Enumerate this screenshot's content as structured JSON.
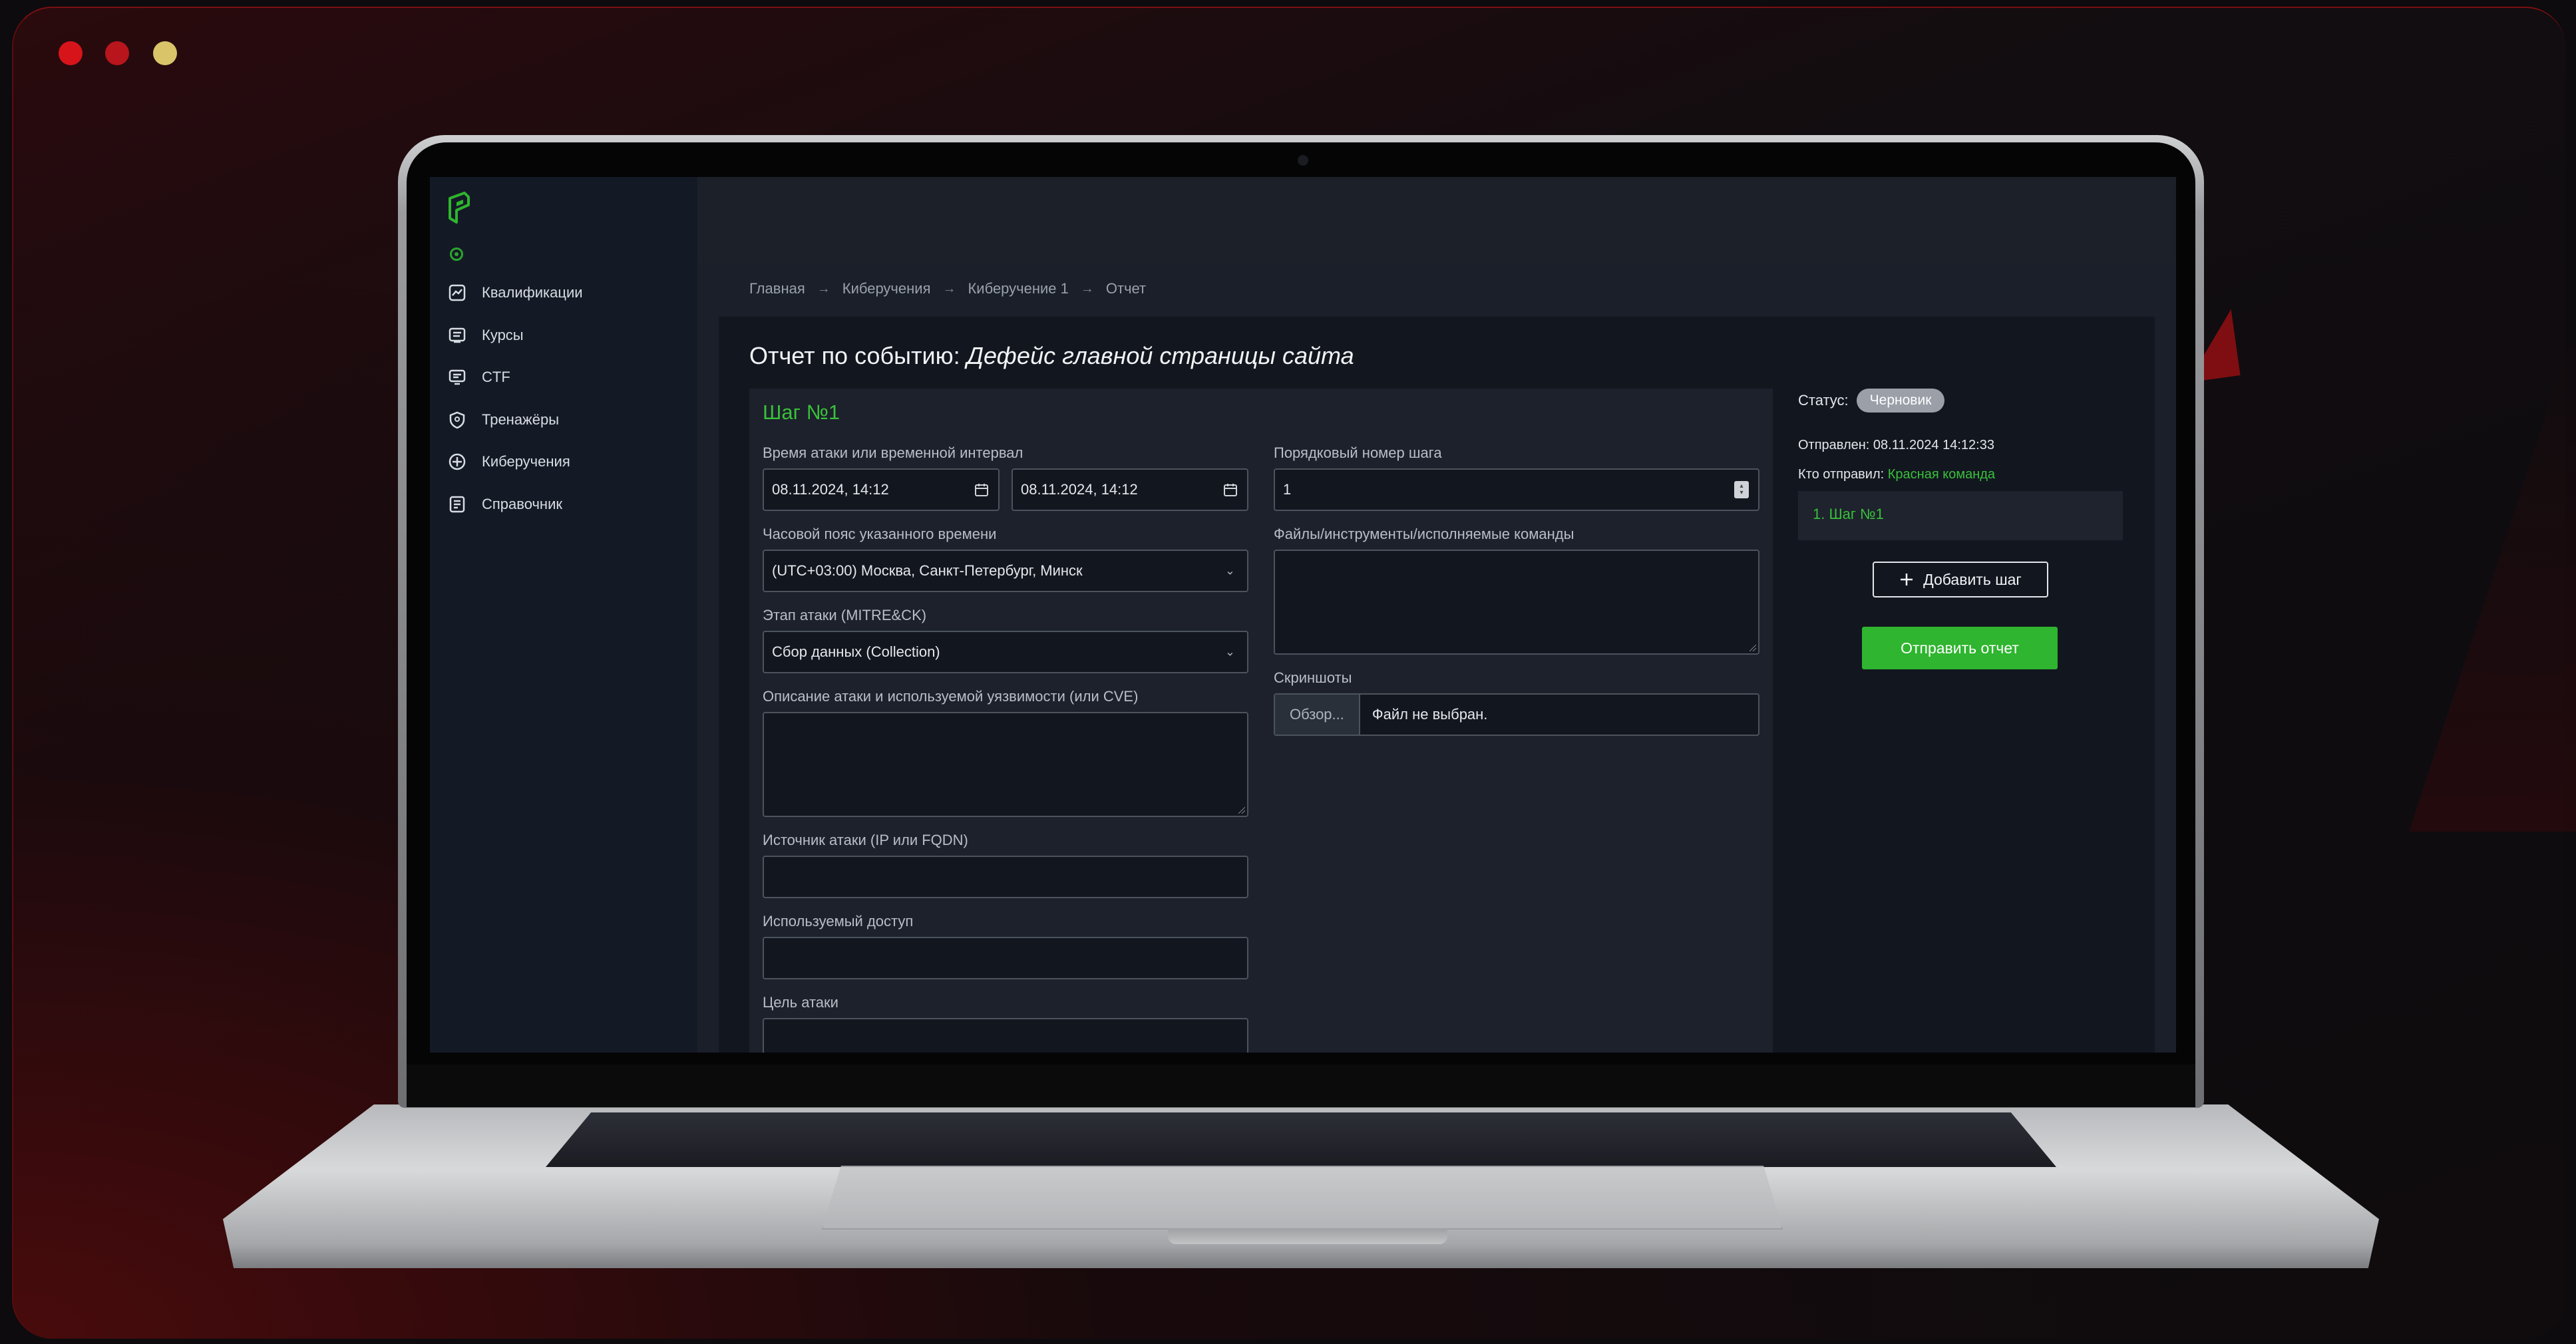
{
  "window_controls": {
    "close_color": "#d8141b",
    "minimize_color": "#b8161c",
    "maximize_color": "#d9c46a"
  },
  "sidebar": {
    "logo": "app-logo",
    "items": [
      {
        "label": "Квалификации",
        "icon": "chart-icon"
      },
      {
        "label": "Курсы",
        "icon": "book-icon"
      },
      {
        "label": "CTF",
        "icon": "monitor-icon"
      },
      {
        "label": "Тренажёры",
        "icon": "shield-icon"
      },
      {
        "label": "Киберучения",
        "icon": "crosshair-icon"
      },
      {
        "label": "Справочник",
        "icon": "document-icon"
      }
    ]
  },
  "breadcrumb": [
    "Главная",
    "Киберучения",
    "Киберучение 1",
    "Отчет"
  ],
  "breadcrumb_separator": "→",
  "report": {
    "title_prefix": "Отчет по событию: ",
    "title_event": "Дефейс главной страницы сайта"
  },
  "step": {
    "title": "Шаг №1",
    "attack_time_label": "Время атаки или временной интервал",
    "time_from": "08.11.2024, 14:12",
    "time_to": "08.11.2024, 14:12",
    "timezone_label": "Часовой пояс указанного времени",
    "timezone_value": "(UTC+03:00) Москва, Санкт-Петербург, Минск",
    "stage_label": "Этап атаки (MITRE&CK)",
    "stage_value": "Сбор данных (Collection)",
    "description_label": "Описание атаки и используемой уязвимости (или CVE)",
    "source_label": "Источник атаки (IP или FQDN)",
    "access_label": "Используемый доступ",
    "target_label": "Цель атаки",
    "step_number_label": "Порядковый номер шага",
    "step_number_value": "1",
    "files_label": "Файлы/инструменты/исполняемые команды",
    "screenshots_label": "Скриншоты",
    "browse_label": "Обзор...",
    "no_file_label": "Файл не выбран."
  },
  "side_panel": {
    "status_label": "Статус:",
    "status_value": "Черновик",
    "sent_label": "Отправлен:",
    "sent_value": "08.11.2024 14:12:33",
    "sender_label": "Кто отправил:",
    "sender_value": "Красная команда",
    "steps": [
      "1. Шаг №1"
    ],
    "add_step_label": "Добавить шаг",
    "submit_label": "Отправить отчет"
  },
  "colors": {
    "accent": "#2fb52f",
    "badge": "#9a9fa8"
  }
}
